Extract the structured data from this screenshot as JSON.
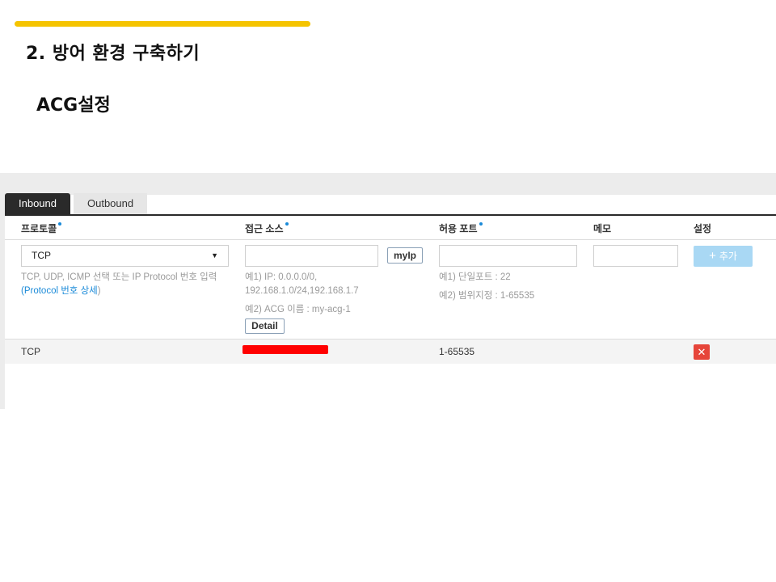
{
  "slide": {
    "title": "2. 방어 환경 구축하기",
    "subtitle": "ACG설정"
  },
  "tabs": [
    {
      "label": "Inbound",
      "active": true
    },
    {
      "label": "Outbound",
      "active": false
    }
  ],
  "columns": {
    "protocol": "프로토콜",
    "source": "접근 소스",
    "port": "허용 포트",
    "memo": "메모",
    "settings": "설정"
  },
  "form": {
    "protocol_selected": "TCP",
    "protocol_hint": "TCP, UDP, ICMP 선택 또는 IP Protocol 번호 입력",
    "protocol_link_open": "(",
    "protocol_link": "Protocol 번호 상세",
    "protocol_link_close": ")",
    "myip_label": "myIp",
    "source_hint_1a": "예1) IP: 0.0.0.0/0,",
    "source_hint_1b": "192.168.1.0/24,192.168.1.7",
    "source_hint_2": "예2) ACG 이름 : my-acg-1",
    "detail_label": "Detail",
    "port_hint_1": "예1) 단일포트 : 22",
    "port_hint_2": "예2) 범위지정 : 1-65535",
    "add_label": "추가"
  },
  "rules": [
    {
      "protocol": "TCP",
      "port": "1-65535",
      "delete_icon": "close-icon"
    }
  ],
  "colors": {
    "accent": "#f5c400",
    "link": "#1a8ad8",
    "delete": "#e6453a",
    "add_disabled": "#a9d8f4"
  }
}
